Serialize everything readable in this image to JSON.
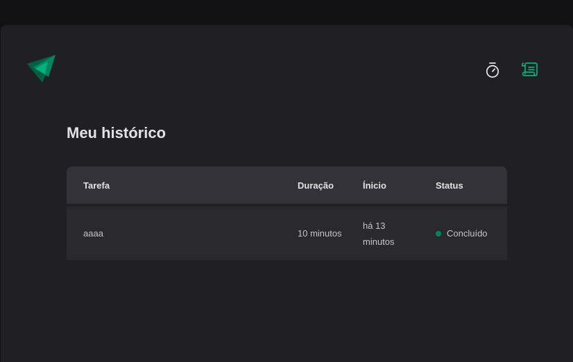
{
  "colors": {
    "brand": "#00875f",
    "brand_light": "#00b37e",
    "status_done": "#00875f",
    "nav_active": "#00b37e"
  },
  "header": {
    "logo_icon": "ignite-triangles-logo",
    "nav": [
      {
        "icon": "timer-icon",
        "active": false
      },
      {
        "icon": "scroll-icon",
        "active": true
      }
    ]
  },
  "page": {
    "title": "Meu histórico"
  },
  "table": {
    "columns": [
      "Tarefa",
      "Duração",
      "Ínicio",
      "Status"
    ],
    "rows": [
      {
        "task": "aaaa",
        "duration": "10 minutos",
        "start": "há 13 minutos",
        "status": "Concluído"
      }
    ]
  }
}
